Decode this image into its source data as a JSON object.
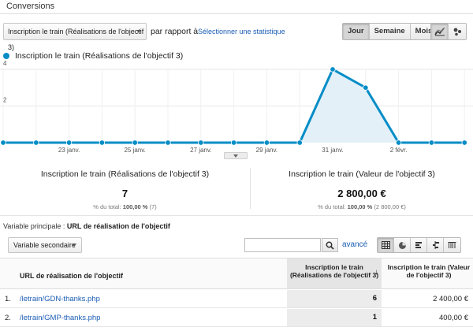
{
  "section_title": "Conversions",
  "toolbar": {
    "metric_select": "Inscription le train (Réalisations de l'objectif 3)",
    "compare_label": "par rapport à",
    "select_stat_link": "Sélectionner une statistique",
    "granularity": [
      "Jour",
      "Semaine",
      "Mois"
    ],
    "granularity_active": "Jour",
    "chart_modes": [
      "line-chart-icon",
      "motion-chart-icon"
    ]
  },
  "legend": {
    "series_name": "Inscription le train (Réalisations de l'objectif 3)",
    "color": "#058dc7"
  },
  "chart_data": {
    "type": "line",
    "x": [
      "21 janv.",
      "22 janv.",
      "23 janv.",
      "24 janv.",
      "25 janv.",
      "26 janv.",
      "27 janv.",
      "28 janv.",
      "29 janv.",
      "30 janv.",
      "31 janv.",
      "1 févr.",
      "2 févr.",
      "3 févr.",
      "4 févr."
    ],
    "series": [
      {
        "name": "Inscription le train (Réalisations de l'objectif 3)",
        "values": [
          0,
          0,
          0,
          0,
          0,
          0,
          0,
          0,
          0,
          0,
          4,
          3,
          0,
          0,
          0
        ]
      }
    ],
    "x_tick_labels": [
      "23 janv.",
      "25 janv.",
      "27 janv.",
      "29 janv.",
      "31 janv.",
      "2 févr."
    ],
    "y_tick_labels": [
      "4",
      "2"
    ],
    "ylim": [
      0,
      4
    ],
    "grid": true,
    "area_fill": true,
    "color": "#058dc7"
  },
  "summary": [
    {
      "label": "Inscription le train (Réalisations de l'objectif 3)",
      "value": "7",
      "pct_prefix": "% du total:",
      "pct_value": "100,00 %",
      "pct_suffix": "(7)"
    },
    {
      "label": "Inscription le train (Valeur de l'objectif 3)",
      "value": "2 800,00 €",
      "pct_prefix": "% du total:",
      "pct_value": "100,00 %",
      "pct_suffix": "(2 800,00 €)"
    }
  ],
  "table_controls": {
    "primary_dim_label": "Variable principale :",
    "primary_dim_value": "URL de réalisation de l'objectif",
    "secondary_select": "Variable secondaire",
    "search_placeholder": "",
    "advanced_link": "avancé",
    "view_modes": [
      "table-view-icon",
      "pie-view-icon",
      "performance-view-icon",
      "comparison-view-icon",
      "pivot-view-icon"
    ]
  },
  "table": {
    "columns": {
      "dimension": "URL de réalisation de l'objectif",
      "metric1": "Inscription le train (Réalisations de l'objectif 3)",
      "metric2": "Inscription le train (Valeur de l'objectif 3)"
    },
    "rows": [
      {
        "num": "1.",
        "url": "/letrain/GDN-thanks.php",
        "m1": "6",
        "m2": "2 400,00 €"
      },
      {
        "num": "2.",
        "url": "/letrain/GMP-thanks.php",
        "m1": "1",
        "m2": "400,00 €"
      }
    ]
  }
}
